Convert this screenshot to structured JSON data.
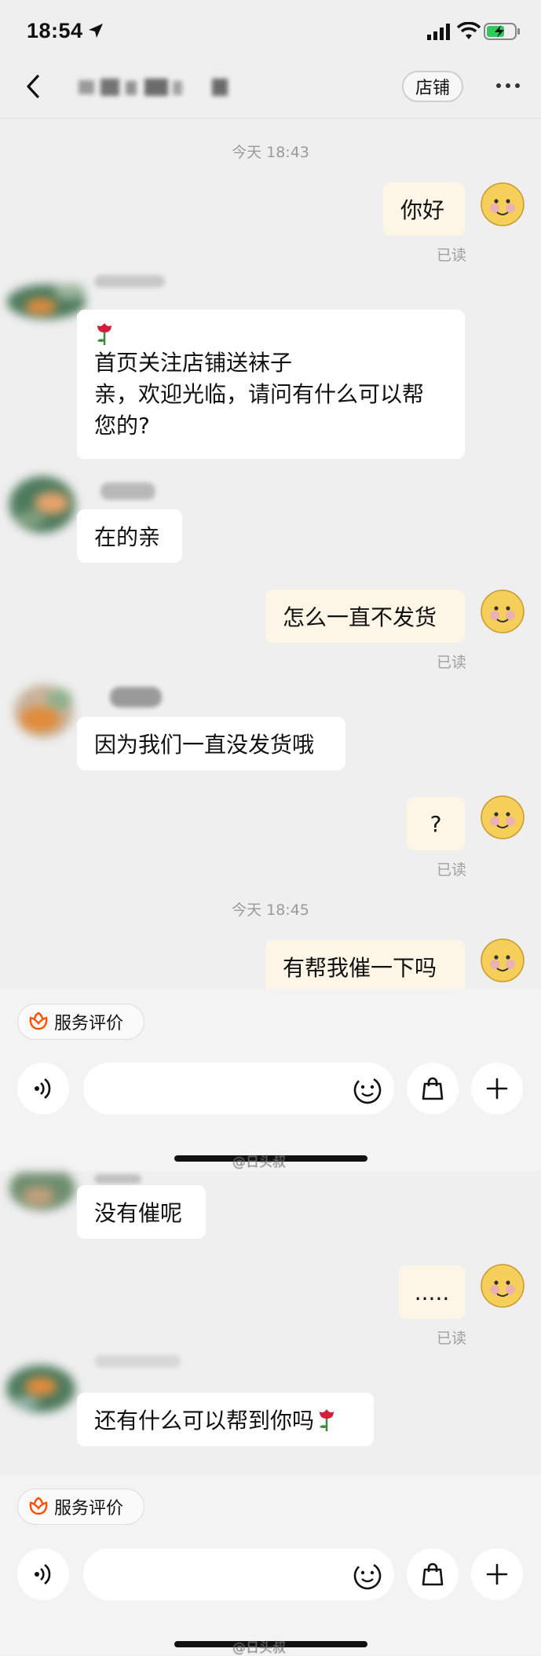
{
  "status_bar": {
    "time": "18:54"
  },
  "header": {
    "store_label": "店铺"
  },
  "timestamps": [
    "今天 18:43",
    "今天 18:45"
  ],
  "read_label": "已读",
  "messages": [
    {
      "side": "right",
      "text": "你好"
    },
    {
      "side": "left",
      "line1": "首页关注店铺送袜子",
      "line2": "亲，欢迎光临，请问有什么可以帮",
      "line3": "您的?"
    },
    {
      "side": "left",
      "text": "在的亲"
    },
    {
      "side": "right",
      "text": "怎么一直不发货"
    },
    {
      "side": "left",
      "text": "因为我们一直没发货哦"
    },
    {
      "side": "right",
      "text": "?"
    },
    {
      "side": "right",
      "text": "有帮我催一下吗"
    },
    {
      "side": "left",
      "text": "没有催呢"
    },
    {
      "side": "right",
      "text": "....."
    },
    {
      "side": "left",
      "text": "还有什么可以帮到你吗"
    }
  ],
  "bottom_bar": {
    "eval_label": "服务评价"
  },
  "watermark": "@日头叔",
  "colors": {
    "accent": "#ff5000",
    "bubble_right": "#fdf6e6",
    "bubble_left": "#ffffff",
    "background": "#efefef"
  }
}
